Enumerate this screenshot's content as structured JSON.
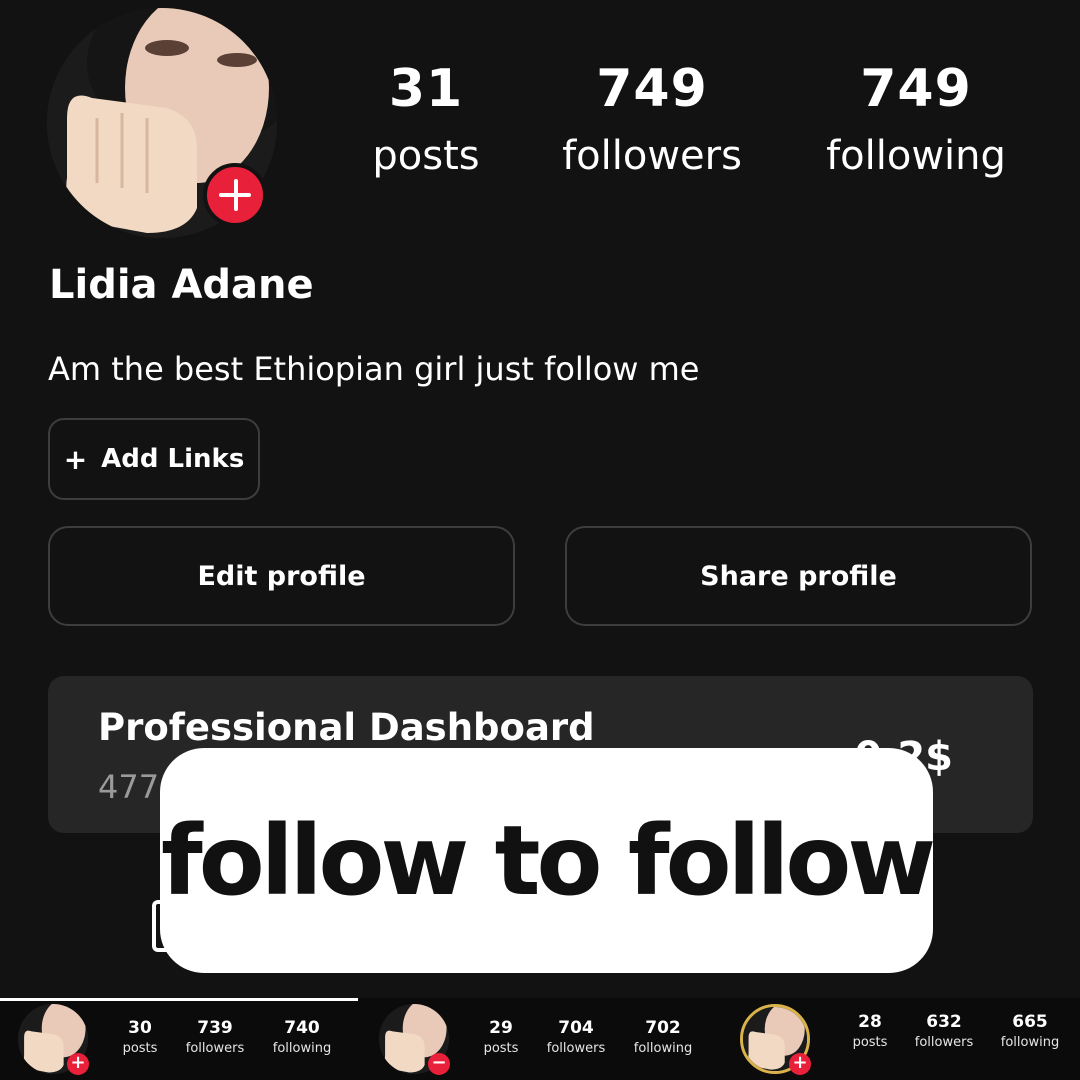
{
  "profile": {
    "name": "Lidia Adane",
    "bio": "Am the best Ethiopian girl just follow me",
    "add_story_icon": "plus-icon"
  },
  "stats": [
    {
      "value": "31",
      "label": "posts"
    },
    {
      "value": "749",
      "label": "followers"
    },
    {
      "value": "749",
      "label": "following"
    }
  ],
  "buttons": {
    "add_links": "Add Links",
    "add_links_icon": "+",
    "edit_profile": "Edit profile",
    "share_profile": "Share profile"
  },
  "dashboard": {
    "title": "Professional Dashboard",
    "subtitle": "477",
    "earnings": "0.2$"
  },
  "caption": {
    "text": "follow to follow"
  },
  "preview_strip": [
    {
      "badge": "+",
      "posts": "30",
      "followers": "739",
      "following": "740",
      "posts_label": "posts",
      "followers_label": "followers",
      "following_label": "following"
    },
    {
      "badge": "−",
      "posts": "29",
      "followers": "704",
      "following": "702",
      "posts_label": "posts",
      "followers_label": "followers",
      "following_label": "following"
    },
    {
      "badge": "+",
      "posts": "28",
      "followers": "632",
      "following": "665",
      "posts_label": "posts",
      "followers_label": "followers",
      "following_label": "following"
    }
  ],
  "colors": {
    "background": "#121212",
    "badge_red": "#e8203a",
    "dashboard_bg": "#262626",
    "caption_bg": "#ffffff",
    "story_ring": "#d9b24a"
  }
}
